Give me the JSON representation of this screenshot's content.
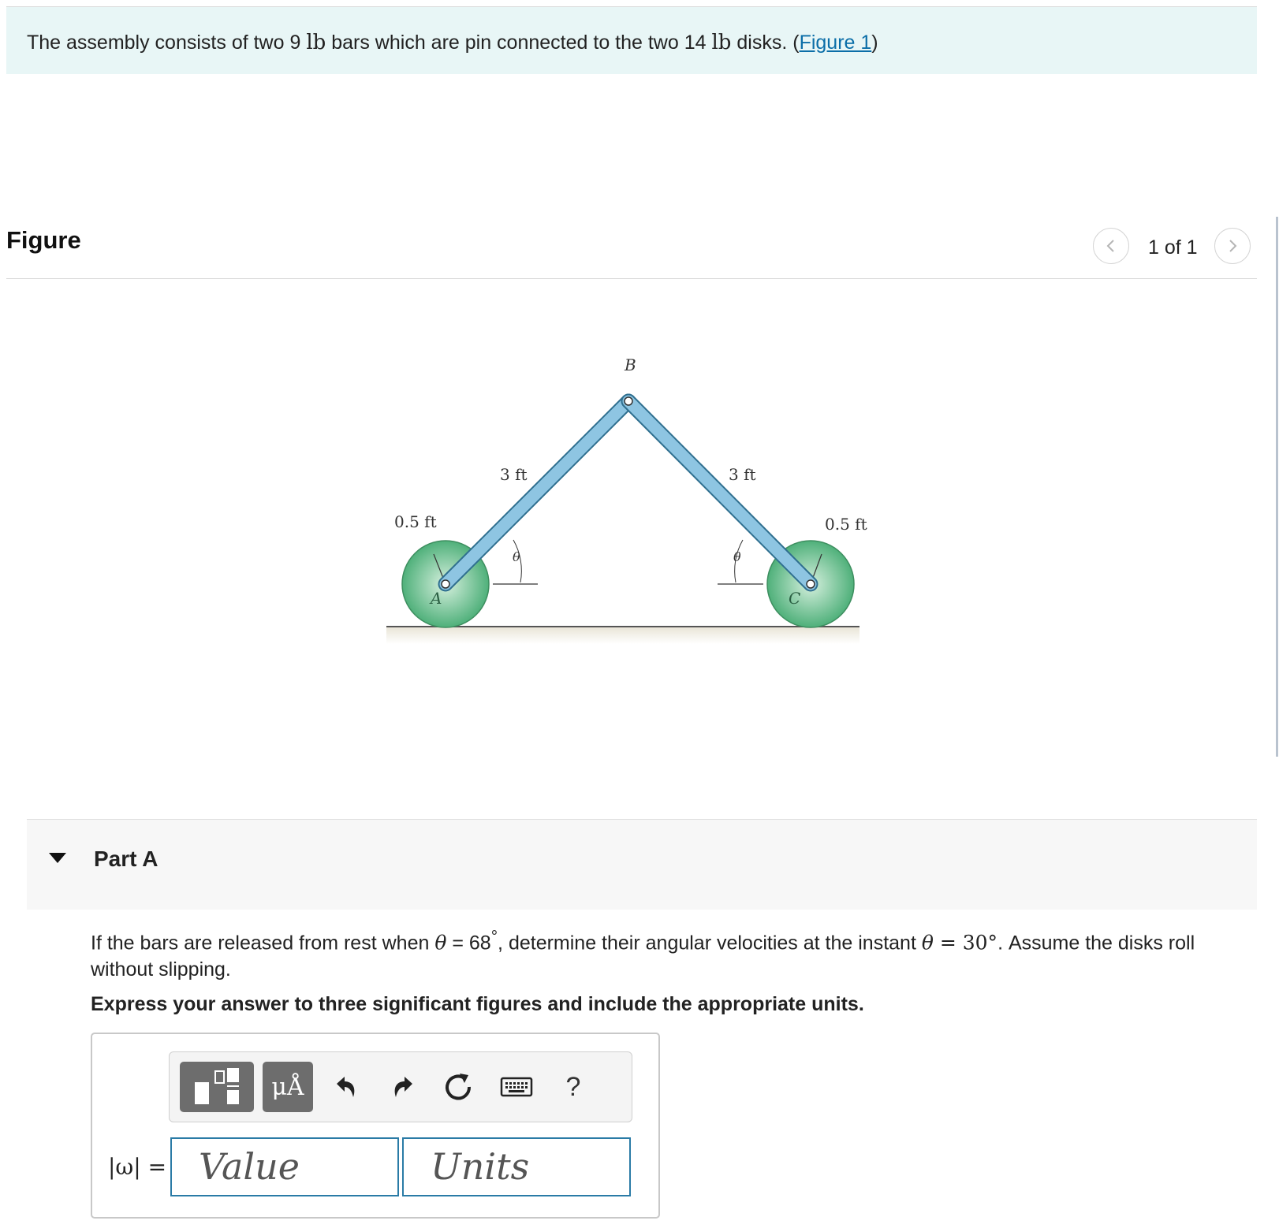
{
  "intro": {
    "text_before": "The assembly consists of two 9 ",
    "unit1": "lb",
    "text_mid": " bars which are pin connected to the two 14 ",
    "unit2": "lb",
    "text_after": " disks. (",
    "figure_link": "Figure 1",
    "text_close": ")"
  },
  "figure_panel": {
    "title": "Figure",
    "pager_text": "1 of 1",
    "labels": {
      "point_b": "B",
      "point_a": "A",
      "point_c": "C",
      "left_bar_length": "3 ft",
      "right_bar_length": "3 ft",
      "left_radius": "0.5 ft",
      "right_radius": "0.5 ft",
      "left_angle": "θ",
      "right_angle": "θ"
    }
  },
  "part": {
    "label": "Part A",
    "q_before": "If the bars are released from rest when ",
    "q_theta1": "θ",
    "q_eq1": " = 68",
    "q_deg1": "°",
    "q_mid": ", determine their angular velocities at the instant ",
    "q_theta2": "θ",
    "q_eq2": " = 30°",
    "q_after": ". Assume the disks roll without slipping.",
    "instruction": "Express your answer to three significant figures and include the appropriate units."
  },
  "answer": {
    "omega_label": "|ω| =",
    "value_placeholder": "Value",
    "units_placeholder": "Units",
    "toolbar": {
      "units_button": "μÅ",
      "help_button": "?"
    }
  },
  "colors": {
    "intro_bg": "#e8f6f6",
    "link": "#0b6ea8",
    "field_border": "#2a7ba6",
    "bar_fill": "#8ec5e2",
    "disk_fill": "#4fb07a"
  }
}
